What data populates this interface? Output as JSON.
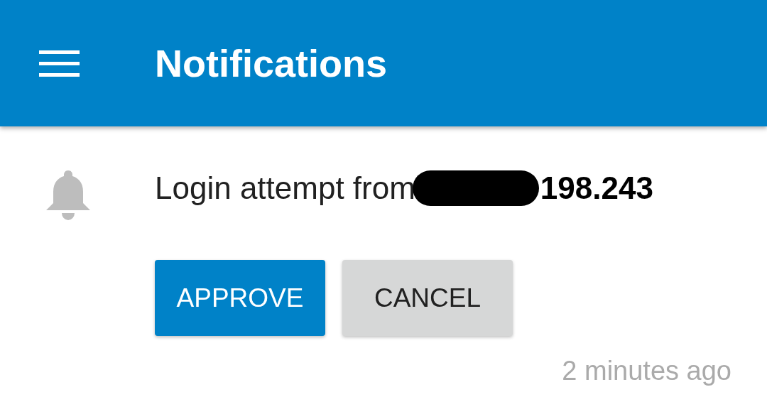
{
  "app_bar": {
    "title": "Notifications"
  },
  "notification": {
    "message": "Login attempt from",
    "address": "198.243",
    "actions": [
      {
        "label": "APPROVE",
        "kind": "primary"
      },
      {
        "label": "CANCEL",
        "kind": "secondary"
      }
    ],
    "time": "2 minutes ago"
  }
}
